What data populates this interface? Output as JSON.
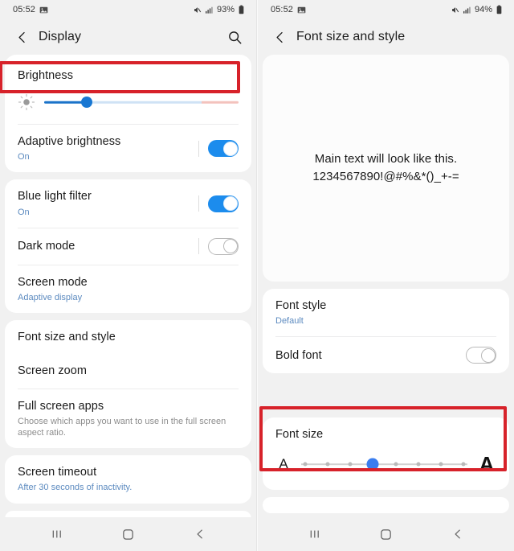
{
  "left_screen": {
    "status_bar": {
      "time": "05:52",
      "image_icon": "image-icon",
      "mute_icon": "mute-icon",
      "signal_icon": "signal-bars-icon",
      "battery_text": "93%",
      "battery_icon": "battery-icon"
    },
    "app_bar": {
      "back_icon": "back-chevron-icon",
      "title": "Display",
      "search_icon": "search-icon"
    },
    "cards": [
      {
        "rows": [
          {
            "name": "brightness",
            "label": "Brightness",
            "type": "header"
          },
          {
            "name": "brightness-slider",
            "type": "brightness-slider",
            "sun_icon": "brightness-sun-icon",
            "value_percent": 22
          },
          {
            "name": "adaptive-brightness",
            "label": "Adaptive brightness",
            "sub": "On",
            "type": "toggle",
            "toggle": "on"
          }
        ]
      },
      {
        "rows": [
          {
            "name": "blue-light-filter",
            "label": "Blue light filter",
            "sub": "On",
            "type": "toggle",
            "toggle": "on"
          },
          {
            "name": "dark-mode",
            "label": "Dark mode",
            "type": "toggle",
            "toggle": "off"
          },
          {
            "name": "screen-mode",
            "label": "Screen mode",
            "sub": "Adaptive display",
            "type": "nav"
          }
        ]
      },
      {
        "rows": [
          {
            "name": "font-size-and-style",
            "label": "Font size and style",
            "type": "nav",
            "highlighted": true
          },
          {
            "name": "screen-zoom",
            "label": "Screen zoom",
            "type": "nav"
          },
          {
            "name": "full-screen-apps",
            "label": "Full screen apps",
            "sub": "Choose which apps you want to use in the full screen aspect ratio.",
            "sub_grey": true,
            "type": "nav"
          }
        ]
      },
      {
        "rows": [
          {
            "name": "screen-timeout",
            "label": "Screen timeout",
            "sub": "After 30 seconds of inactivity.",
            "type": "nav"
          }
        ]
      }
    ],
    "nav_bar": {
      "recents_icon": "recents-icon",
      "home_icon": "home-icon",
      "back_icon": "back-chevron-icon"
    }
  },
  "right_screen": {
    "status_bar": {
      "time": "05:52",
      "image_icon": "image-icon",
      "mute_icon": "mute-icon",
      "signal_icon": "signal-bars-icon",
      "battery_text": "94%",
      "battery_icon": "battery-icon"
    },
    "app_bar": {
      "back_icon": "back-chevron-icon",
      "title": "Font size and style"
    },
    "preview": {
      "line1": "Main text will look like this.",
      "line2": "1234567890!@#%&*()_+-="
    },
    "cards": [
      {
        "rows": [
          {
            "name": "font-style",
            "label": "Font style",
            "sub": "Default",
            "type": "nav"
          },
          {
            "name": "bold-font",
            "label": "Bold font",
            "type": "toggle",
            "toggle": "off"
          }
        ]
      }
    ],
    "font_size": {
      "label": "Font size",
      "small_letter": "A",
      "large_letter": "A",
      "ticks": 8,
      "selected_index": 3,
      "highlighted": true
    },
    "nav_bar": {
      "recents_icon": "recents-icon",
      "home_icon": "home-icon",
      "back_icon": "back-chevron-icon"
    }
  },
  "colors": {
    "accent_blue": "#1c8ced",
    "slider_blue": "#3a7def",
    "highlight_red": "#d7222a",
    "sub_blue": "#5d8bc0",
    "bg_grey": "#f1f1f1"
  }
}
